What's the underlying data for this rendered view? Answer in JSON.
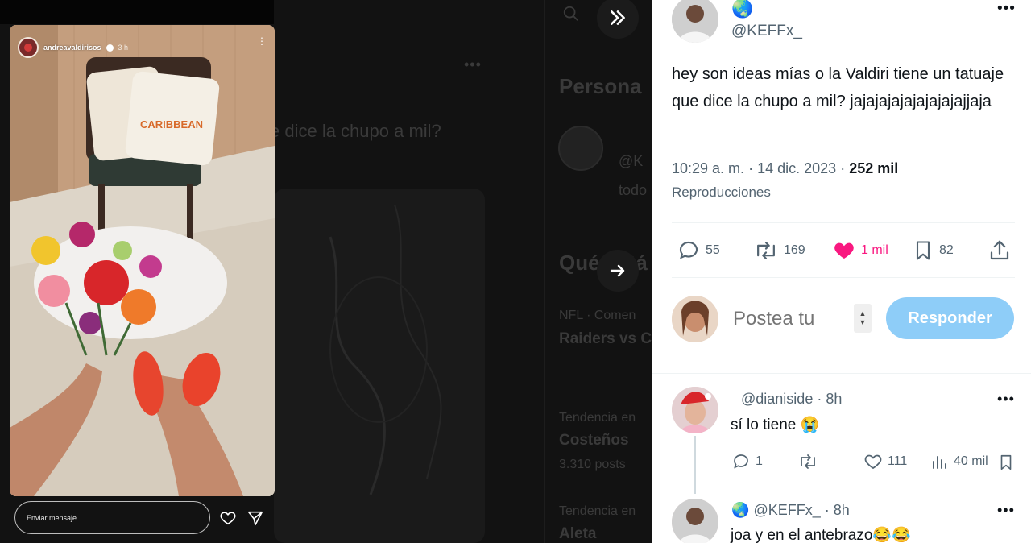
{
  "story": {
    "username": "andreavaldirisos",
    "time": "3 h",
    "pillow_text": "CARIBBEAN",
    "reply_placeholder": "Enviar mensaje"
  },
  "background": {
    "heading": "Persona",
    "tweet_fragment": "e dice la chupo a mil?",
    "trends_heading": "Qué está",
    "trend1_category": "NFL · Comen",
    "trend1_title": "Raiders vs C",
    "trend2_category": "Tendencia en",
    "trend2_title": "Costeños",
    "trend2_posts": "3.310 posts",
    "trend3_category": "Tendencia en",
    "trend3_title": "Aleta",
    "who_handle": "@K",
    "who_sub": "todo"
  },
  "tweet": {
    "handle": "@KEFFx_",
    "text": "hey son ideas mías o la Valdiri tiene un tatuaje que dice la chupo a mil? jajajajajajajajajajjaja",
    "time": "10:29 a. m.",
    "date": "14 dic. 2023",
    "views_count": "252 mil",
    "views_label": "Reproducciones",
    "separator": "·",
    "actions": {
      "replies": "55",
      "retweets": "169",
      "likes": "1 mil",
      "bookmarks": "82"
    }
  },
  "composer": {
    "placeholder": "Postea tu",
    "button": "Responder"
  },
  "replies": [
    {
      "handle": "@dianiside",
      "time": "· 8h",
      "text": "sí lo tiene 😭",
      "replies": "1",
      "retweets": "",
      "likes": "111",
      "views": "40 mil"
    },
    {
      "handle": "@KEFFx_",
      "time": "· 8h",
      "text": "joa y en el antebrazo😂😂"
    }
  ],
  "colors": {
    "like": "#f91880",
    "reply_button": "#8ecdf8",
    "secondary_text": "#536471"
  }
}
